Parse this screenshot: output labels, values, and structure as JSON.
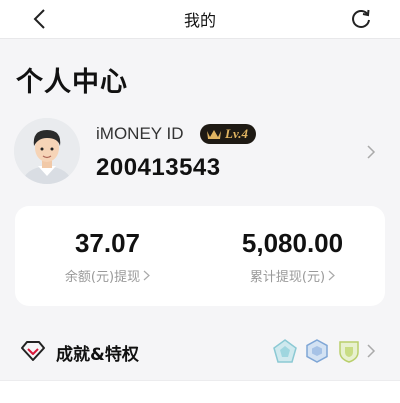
{
  "header": {
    "title": "我的"
  },
  "page": {
    "title": "个人中心"
  },
  "profile": {
    "id_label": "iMONEY ID",
    "level": "Lv.4",
    "id_value": "200413543"
  },
  "stats": [
    {
      "value": "37.07",
      "label": "余额(元)提现"
    },
    {
      "value": "5,080.00",
      "label": "累计提现(元)"
    }
  ],
  "achievements": {
    "label": "成就&特权",
    "medals": [
      "teal-pentagon-medal",
      "blue-hexagon-medal",
      "green-shield-medal"
    ]
  },
  "colors": {
    "badge_bg": "#1e1a14",
    "badge_gold": "#e0b461",
    "accent_red": "#d8173a"
  }
}
